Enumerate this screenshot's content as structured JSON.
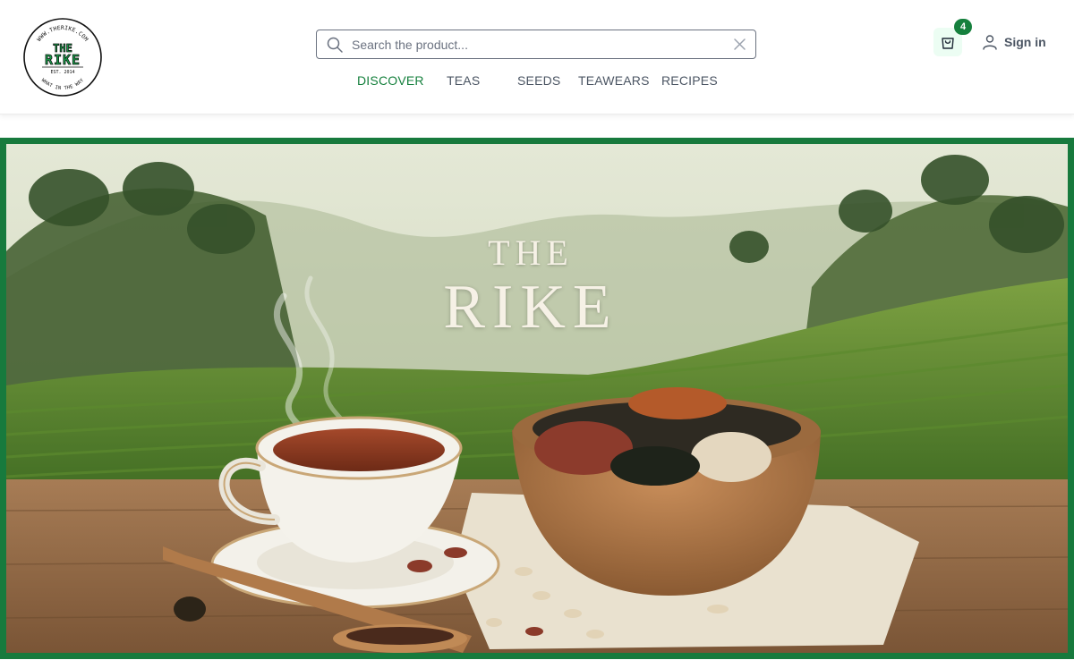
{
  "brand": {
    "logo_ring_text": "WWW.THERIKE.COM",
    "logo_line1": "THE",
    "logo_line2": "RIKE",
    "logo_est": "EST. 2014",
    "logo_tagline": "WHAT IN THE WAY",
    "accent_color": "#15803d"
  },
  "search": {
    "placeholder": "Search the product...",
    "value": "",
    "icon": "search-icon",
    "clear_icon": "close-icon"
  },
  "nav": {
    "items": [
      {
        "label": "DISCOVER",
        "active": true
      },
      {
        "label": "TEAS",
        "active": false
      },
      {
        "label": "SEEDS",
        "active": false
      },
      {
        "label": "TEAWEARS",
        "active": false
      },
      {
        "label": "RECIPES",
        "active": false
      }
    ]
  },
  "cart": {
    "icon": "shopping-bag-icon",
    "count": "4"
  },
  "account": {
    "icon": "user-icon",
    "signin_label": "Sign in"
  },
  "hero": {
    "title_top": "THE",
    "title_main": "RIKE",
    "border_color": "#177a3d"
  }
}
